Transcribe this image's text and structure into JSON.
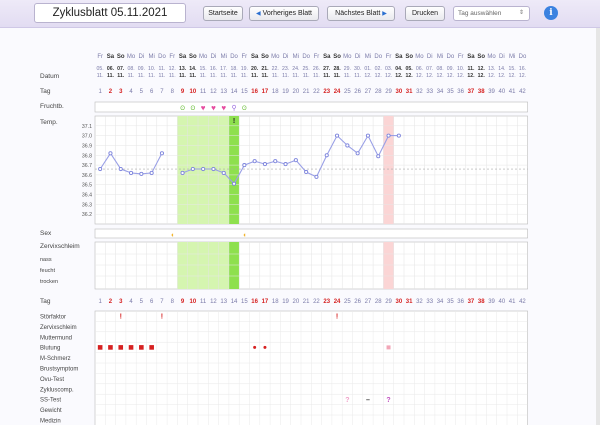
{
  "header": {
    "title": "Zyklusblatt 05.11.2021",
    "buttons": {
      "start": "Startseite",
      "prev": "Vorheriges Blatt",
      "next": "Nächstes Blatt",
      "print": "Drucken"
    },
    "day_select": "Tag auswählen",
    "info_icon": "info-icon",
    "colors": {
      "accent": "#3b82e0",
      "bar": "#e6e0f4"
    }
  },
  "weekdays": [
    "Fr",
    "Sa",
    "So",
    "Mo",
    "Di",
    "Mi",
    "Do",
    "Fr",
    "Sa",
    "So",
    "Mo",
    "Di",
    "Mi",
    "Do",
    "Fr",
    "Sa",
    "So",
    "Mo",
    "Di",
    "Mi",
    "Do",
    "Fr",
    "Sa",
    "So",
    "Mo",
    "Di",
    "Mi",
    "Do",
    "Fr",
    "Sa",
    "So",
    "Mo",
    "Di",
    "Mi",
    "Do",
    "Fr",
    "Sa",
    "So",
    "Mo",
    "Di",
    "Mi",
    "Do"
  ],
  "dates": [
    "05.",
    "06.",
    "07.",
    "08.",
    "09.",
    "10.",
    "11.",
    "12.",
    "13.",
    "14.",
    "15.",
    "16.",
    "17.",
    "18.",
    "19.",
    "20.",
    "21.",
    "22.",
    "23.",
    "24.",
    "25.",
    "26.",
    "27.",
    "28.",
    "29.",
    "30.",
    "01.",
    "02.",
    "03.",
    "04.",
    "05.",
    "06.",
    "07.",
    "08.",
    "09.",
    "10.",
    "11.",
    "12.",
    "13.",
    "14.",
    "15.",
    "16."
  ],
  "months": [
    "11.",
    "11.",
    "11.",
    "11.",
    "11.",
    "11.",
    "11.",
    "11.",
    "11.",
    "11.",
    "11.",
    "11.",
    "11.",
    "11.",
    "11.",
    "11.",
    "11.",
    "11.",
    "11.",
    "11.",
    "11.",
    "11.",
    "11.",
    "11.",
    "11.",
    "11.",
    "12.",
    "12.",
    "12.",
    "12.",
    "12.",
    "12.",
    "12.",
    "12.",
    "12.",
    "12.",
    "12.",
    "12.",
    "12.",
    "12.",
    "12.",
    "12."
  ],
  "days": [
    "1",
    "2",
    "3",
    "4",
    "5",
    "6",
    "7",
    "8",
    "9",
    "10",
    "11",
    "12",
    "13",
    "14",
    "15",
    "16",
    "17",
    "18",
    "19",
    "20",
    "21",
    "22",
    "23",
    "24",
    "25",
    "26",
    "27",
    "28",
    "29",
    "30",
    "31",
    "32",
    "33",
    "34",
    "35",
    "36",
    "37",
    "38",
    "39",
    "40",
    "41",
    "42"
  ],
  "red_days": [
    2,
    3,
    9,
    10,
    16,
    17,
    23,
    24,
    30,
    31,
    37,
    38
  ],
  "labels": {
    "datum": "Datum",
    "tag": "Tag",
    "fruchtb": "Fruchtb.",
    "temp": "Temp.",
    "sex": "Sex",
    "zervix": "Zervixschleim",
    "nass": "nass",
    "feucht": "feucht",
    "trocken": "trocken",
    "tag2": "Tag",
    "stoer": "Störfaktor",
    "zervix2": "Zervixschleim",
    "mumu": "Muttermund",
    "blutung": "Blutung",
    "mschmerz": "M-Schmerz",
    "brust": "Brustsymptom",
    "ovu": "Ovu-Test",
    "zyklus": "Zykluscomp.",
    "ss": "SS-Test",
    "gewicht": "Gewicht",
    "medizin": "Medizin"
  },
  "temp_scale": [
    "37.1",
    "37.0",
    "36.9",
    "36.8",
    "36.7",
    "36.6",
    "36.5",
    "36.4",
    "36.3",
    "36.2"
  ],
  "temperatures": [
    36.66,
    36.82,
    36.66,
    36.62,
    36.61,
    36.62,
    36.82,
    null,
    36.62,
    36.66,
    36.66,
    36.66,
    36.62,
    36.51,
    36.7,
    36.74,
    36.71,
    36.74,
    36.71,
    36.75,
    36.63,
    36.58,
    36.8,
    37.0,
    36.9,
    36.82,
    37.0,
    36.79,
    37.0,
    37.0
  ],
  "coverline": 36.66,
  "fertile_light": [
    9,
    10,
    11,
    12,
    13
  ],
  "fertile_dark": [
    14
  ],
  "peak_day": 14,
  "period_highlight_day": 29,
  "peak_marker": "!",
  "fruchtb_icons": [
    {
      "day": 9,
      "icon": "leaf-icon"
    },
    {
      "day": 10,
      "icon": "leaf-icon"
    },
    {
      "day": 11,
      "icon": "heart-icon"
    },
    {
      "day": 12,
      "icon": "heart-icon"
    },
    {
      "day": 13,
      "icon": "heart-icon"
    },
    {
      "day": 14,
      "icon": "key-icon"
    },
    {
      "day": 15,
      "icon": "leaf-icon"
    }
  ],
  "sex_days": [
    8,
    15
  ],
  "stoer_days": [
    3,
    7,
    24
  ],
  "stoer_marker": "!",
  "blutung_days": [
    1,
    2,
    3,
    4,
    5,
    6
  ],
  "mschmerz_days": [
    16,
    17
  ],
  "ss_test": [
    {
      "day": 25,
      "mark": "?",
      "color": "#f0a0c8"
    },
    {
      "day": 27,
      "mark": "–",
      "color": "#333333"
    },
    {
      "day": 29,
      "mark": "?",
      "color": "#c050c0"
    }
  ],
  "ovu_test": [
    {
      "day": 29,
      "color": "#f2a7b8"
    }
  ]
}
